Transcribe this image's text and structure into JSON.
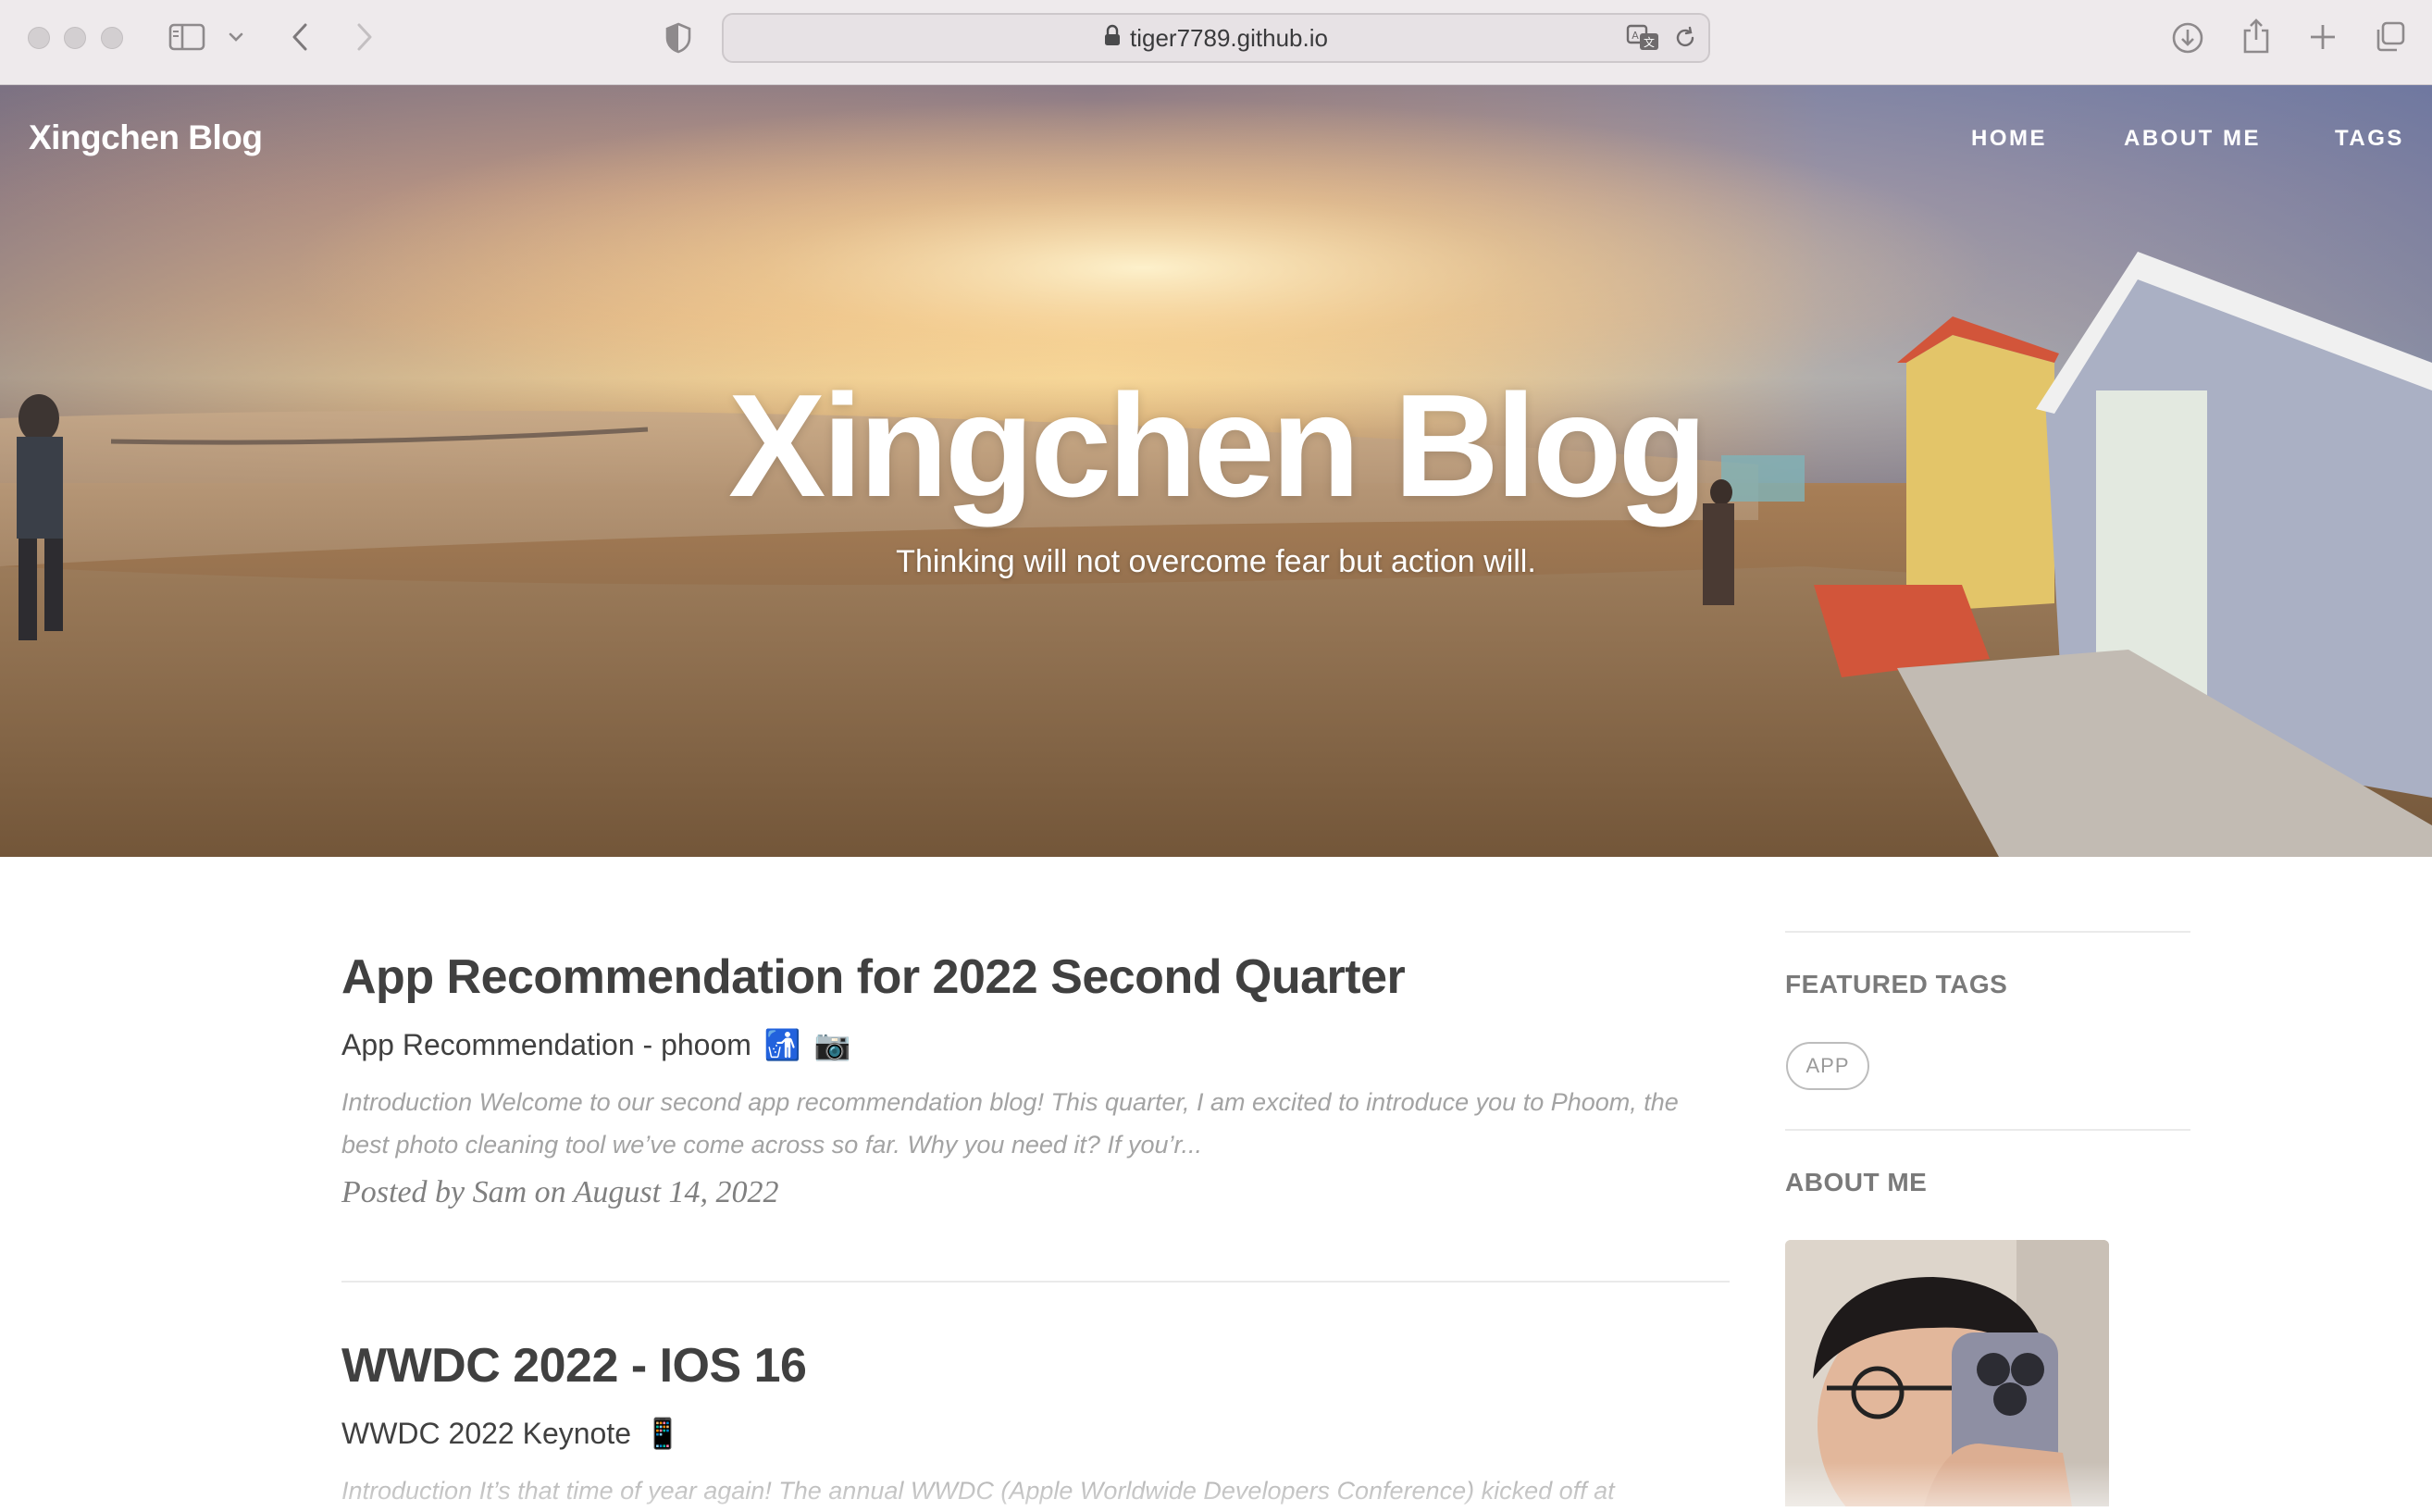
{
  "browser": {
    "url": "tiger7789.github.io"
  },
  "site": {
    "brand": "Xingchen Blog",
    "nav": [
      "HOME",
      "ABOUT ME",
      "TAGS"
    ],
    "hero_title": "Xingchen Blog",
    "hero_subtitle": "Thinking will not overcome fear but action will."
  },
  "posts": [
    {
      "title": "App Recommendation for 2022 Second Quarter",
      "subtitle": "App Recommendation - phoom",
      "subtitle_emoji": [
        "🚮",
        "📷"
      ],
      "excerpt": "Introduction Welcome to our second app recommendation blog! This quarter, I am excited to introduce you to Phoom, the best photo cleaning tool we’ve come across so far. Why you need it? If you’r...",
      "meta": "Posted by Sam on August 14, 2022"
    },
    {
      "title": "WWDC 2022 - IOS 16",
      "subtitle": "WWDC 2022 Keynote",
      "subtitle_emoji": [
        "📱"
      ],
      "excerpt": "Introduction It’s that time of year again! The annual WWDC (Apple Worldwide Developers Conference) kicked off at"
    }
  ],
  "sidebar": {
    "featured_tags_heading": "FEATURED TAGS",
    "tags": [
      "APP"
    ],
    "about_heading": "ABOUT ME"
  }
}
